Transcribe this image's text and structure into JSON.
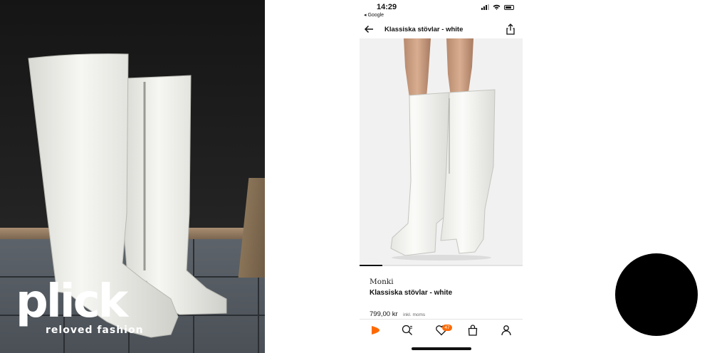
{
  "logo": {
    "word": "plick",
    "tagline": "reloved fashion"
  },
  "status_bar": {
    "time": "14:29",
    "back_app": "◂ Google"
  },
  "header": {
    "title": "Klassiska stövlar - white"
  },
  "product": {
    "brand": "Monki",
    "name": "Klassiska stövlar - white",
    "price": "799,00 kr",
    "vat_note": "inkl. moms",
    "image_count_indicator": 0.14
  },
  "tabbar": {
    "wishlist_badge": "47",
    "icons": [
      "zalando-home-icon",
      "search-icon",
      "heart-icon",
      "bag-icon",
      "profile-icon"
    ]
  },
  "colors": {
    "accent": "#ff6900",
    "text": "#111111",
    "circle": "#000000"
  }
}
